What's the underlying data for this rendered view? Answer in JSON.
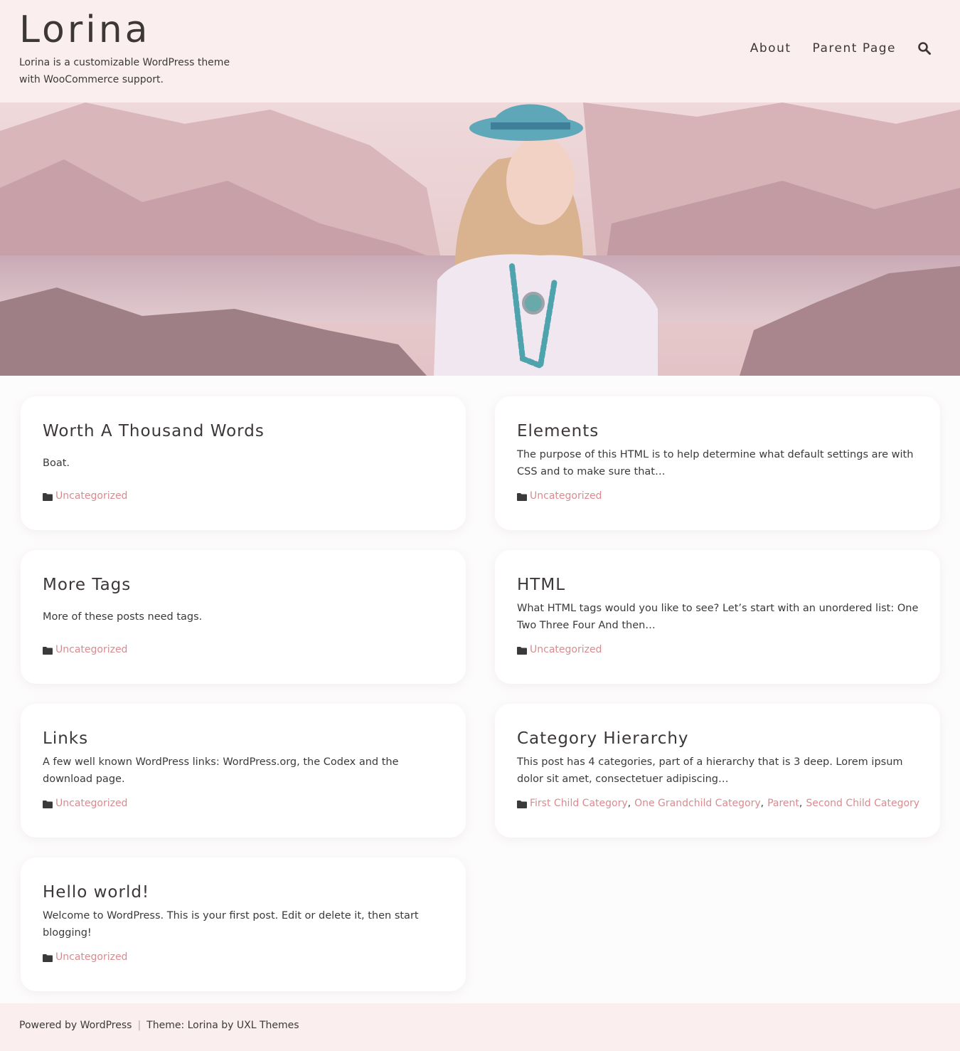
{
  "site": {
    "title": "Lorina",
    "description": "Lorina is a customizable WordPress theme with WooCommerce support."
  },
  "nav": {
    "items": [
      {
        "label": "About"
      },
      {
        "label": "Parent Page"
      }
    ]
  },
  "colors": {
    "header_bg": "#fbeeee",
    "accent_link": "#d98b90",
    "text": "#3a3a3a"
  },
  "posts": [
    {
      "title": "Worth A Thousand Words",
      "excerpt": "Boat.",
      "categories": [
        "Uncategorized"
      ]
    },
    {
      "title": "Elements",
      "excerpt": "The purpose of this HTML is to help determine what default settings are with CSS and to make sure that…",
      "categories": [
        "Uncategorized"
      ]
    },
    {
      "title": "More Tags",
      "excerpt": "More of these posts need tags.",
      "categories": [
        "Uncategorized"
      ]
    },
    {
      "title": "HTML",
      "excerpt": "What HTML tags would you like to see? Let’s start with an unordered list: One Two Three Four And then…",
      "categories": [
        "Uncategorized"
      ]
    },
    {
      "title": "Links",
      "excerpt": "A few well known WordPress links: WordPress.org, the Codex and the download page.",
      "categories": [
        "Uncategorized"
      ]
    },
    {
      "title": "Category Hierarchy",
      "excerpt": "This post has 4 categories, part of a hierarchy that is 3 deep. Lorem ipsum dolor sit amet, consectetuer adipiscing…",
      "categories": [
        "First Child Category",
        "One Grandchild Category",
        "Parent",
        "Second Child Category"
      ],
      "separator": ","
    },
    {
      "title": "Hello world!",
      "excerpt": "Welcome to WordPress. This is your first post. Edit or delete it, then start blogging!",
      "categories": [
        "Uncategorized"
      ]
    }
  ],
  "footer": {
    "powered": "Powered by WordPress",
    "separator": "|",
    "theme": "Theme: Lorina by UXL Themes"
  }
}
